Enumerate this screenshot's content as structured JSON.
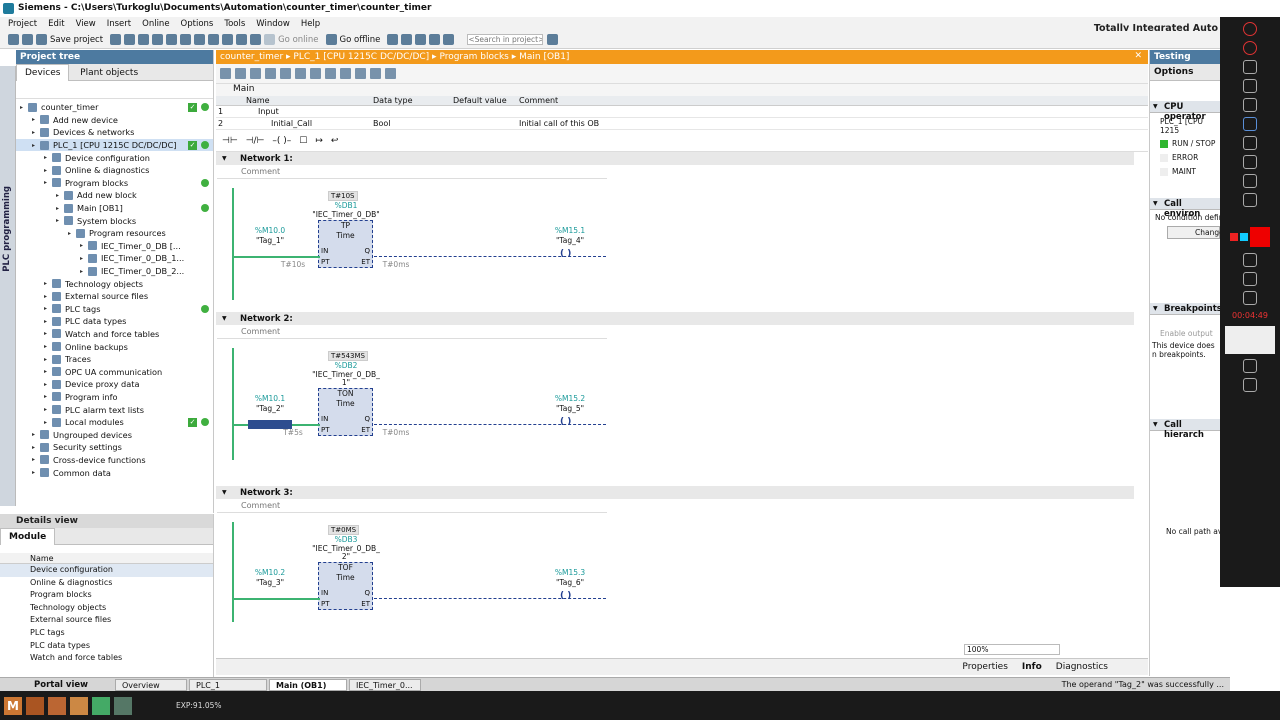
{
  "window": {
    "title": "Siemens - C:\\Users\\Turkoglu\\Documents\\Automation\\counter_timer\\counter_timer"
  },
  "menu": [
    "Project",
    "Edit",
    "View",
    "Insert",
    "Online",
    "Options",
    "Tools",
    "Window",
    "Help"
  ],
  "toolbar": {
    "save": "Save project",
    "go_online": "Go online",
    "go_offline": "Go offline",
    "search_placeholder": "<Search in project>"
  },
  "brand": "Totally Integrated Auto",
  "project_tree": {
    "title": "Project tree",
    "vertical_tab": "PLC programming",
    "tabs": [
      "Devices",
      "Plant objects"
    ],
    "items": [
      {
        "label": "counter_timer",
        "indent": 0
      },
      {
        "label": "Add new device",
        "indent": 1
      },
      {
        "label": "Devices & networks",
        "indent": 1
      },
      {
        "label": "PLC_1 [CPU 1215C DC/DC/DC]",
        "indent": 1
      },
      {
        "label": "Device configuration",
        "indent": 2
      },
      {
        "label": "Online & diagnostics",
        "indent": 2
      },
      {
        "label": "Program blocks",
        "indent": 2
      },
      {
        "label": "Add new block",
        "indent": 3
      },
      {
        "label": "Main [OB1]",
        "indent": 3
      },
      {
        "label": "System blocks",
        "indent": 3
      },
      {
        "label": "Program resources",
        "indent": 4
      },
      {
        "label": "IEC_Timer_0_DB [...",
        "indent": 5
      },
      {
        "label": "IEC_Timer_0_DB_1...",
        "indent": 5
      },
      {
        "label": "IEC_Timer_0_DB_2...",
        "indent": 5
      },
      {
        "label": "Technology objects",
        "indent": 2
      },
      {
        "label": "External source files",
        "indent": 2
      },
      {
        "label": "PLC tags",
        "indent": 2
      },
      {
        "label": "PLC data types",
        "indent": 2
      },
      {
        "label": "Watch and force tables",
        "indent": 2
      },
      {
        "label": "Online backups",
        "indent": 2
      },
      {
        "label": "Traces",
        "indent": 2
      },
      {
        "label": "OPC UA communication",
        "indent": 2
      },
      {
        "label": "Device proxy data",
        "indent": 2
      },
      {
        "label": "Program info",
        "indent": 2
      },
      {
        "label": "PLC alarm text lists",
        "indent": 2
      },
      {
        "label": "Local modules",
        "indent": 2
      },
      {
        "label": "Ungrouped devices",
        "indent": 1
      },
      {
        "label": "Security settings",
        "indent": 1
      },
      {
        "label": "Cross-device functions",
        "indent": 1
      },
      {
        "label": "Common data",
        "indent": 1
      }
    ]
  },
  "details": {
    "title": "Details view",
    "tab": "Module",
    "col": "Name",
    "items": [
      "Device configuration",
      "Online & diagnostics",
      "Program blocks",
      "Technology objects",
      "External source files",
      "PLC tags",
      "PLC data types",
      "Watch and force tables"
    ]
  },
  "editor": {
    "breadcrumb": [
      "counter_timer",
      "PLC_1 [CPU 1215C DC/DC/DC]",
      "Program blocks",
      "Main [OB1]"
    ],
    "block_name": "Main",
    "iface_cols": [
      "Name",
      "Data type",
      "Default value",
      "Comment"
    ],
    "iface_rows": [
      {
        "no": "1",
        "name": "Input",
        "type": "",
        "comment": ""
      },
      {
        "no": "2",
        "name": "Initial_Call",
        "type": "Bool",
        "comment": "Initial call of this OB"
      }
    ],
    "networks": [
      {
        "title": "Network 1:",
        "comment": "Comment",
        "value": "T#10S",
        "db": "%DB1",
        "instance": "\"IEC_Timer_0_DB\"",
        "instance2": "",
        "type": "TP",
        "time": "Time",
        "in_addr": "%M10.0",
        "in_tag": "\"Tag_1\"",
        "pt": "T#10s",
        "et": "T#0ms",
        "out_addr": "%M15.1",
        "out_tag": "\"Tag_4\""
      },
      {
        "title": "Network 2:",
        "comment": "Comment",
        "value": "T#543MS",
        "db": "%DB2",
        "instance": "\"IEC_Timer_0_DB_",
        "instance2": "1\"",
        "type": "TON",
        "time": "Time",
        "in_addr": "%M10.1",
        "in_tag": "\"Tag_2\"",
        "pt": "T#5s",
        "et": "T#0ms",
        "out_addr": "%M15.2",
        "out_tag": "\"Tag_5\""
      },
      {
        "title": "Network 3:",
        "comment": "Comment",
        "value": "T#0MS",
        "db": "%DB3",
        "instance": "\"IEC_Timer_0_DB_",
        "instance2": "2\"",
        "type": "TOF",
        "time": "Time",
        "in_addr": "%M10.2",
        "in_tag": "\"Tag_3\"",
        "pt": "",
        "et": "",
        "out_addr": "%M15.3",
        "out_tag": "\"Tag_6\""
      }
    ],
    "pin_in": "IN",
    "pin_pt": "PT",
    "pin_q": "Q",
    "pin_et": "ET",
    "zoom": "100%"
  },
  "right": {
    "title": "Testing",
    "tab": "Options",
    "cpu_section": "CPU operator",
    "cpu_name": "PLC_1 [CPU 1215",
    "run_stop": "RUN / STOP",
    "error": "ERROR",
    "maint": "MAINT",
    "call_env": "Call environ",
    "cond": "No condition defin",
    "change": "Change",
    "breakpoints": "Breakpoints",
    "enable_output": "Enable output",
    "bp_msg": "This device does n breakpoints.",
    "call_hier": "Call hierarch",
    "no_call": "No call path available"
  },
  "statusbar": {
    "properties": "Properties",
    "info": "Info",
    "diagnostics": "Diagnostics"
  },
  "taskbar": {
    "portal": "Portal view",
    "tabs": [
      "Overview",
      "PLC_1",
      "Main (OB1)",
      "IEC_Timer_0..."
    ],
    "message": "The operand \"Tag_2\" was successfully ..."
  },
  "recorder": {
    "time": "00:04:49",
    "exp": "EXP:91.05%"
  },
  "colors": {
    "accent_orange": "#f39a1b",
    "green_wire": "#3cb371",
    "blue_block": "#223f8f"
  }
}
